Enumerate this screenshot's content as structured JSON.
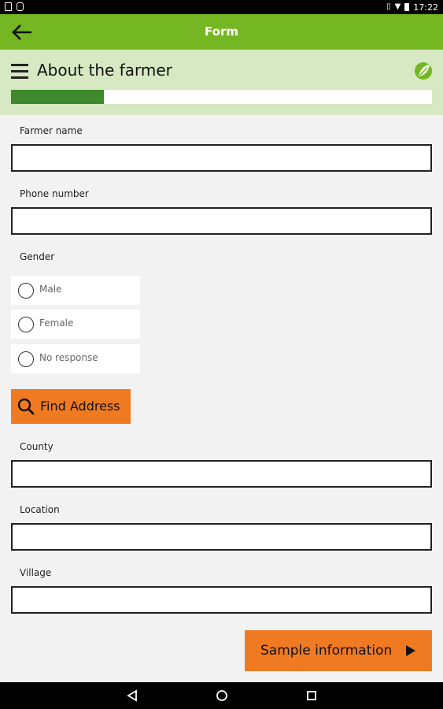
{
  "status_bar": {
    "time": "17:22",
    "icons": [
      "notification-icon",
      "notification-icon",
      "vibrate-icon",
      "wifi-icon",
      "battery-icon"
    ]
  },
  "app_bar": {
    "title": "Form",
    "back_icon": "back-arrow-icon"
  },
  "section": {
    "title": "About the farmer",
    "menu_icon": "hamburger-menu-icon",
    "logo_icon": "leaf-icon",
    "progress": 0.22,
    "colors": {
      "track": "#ffffff",
      "fill": "#3e8a2c",
      "header_bg": "#d6e9c3"
    }
  },
  "form": {
    "farmer_name": {
      "label": "Farmer name",
      "value": ""
    },
    "phone_number": {
      "label": "Phone number",
      "value": ""
    },
    "gender": {
      "label": "Gender",
      "options": [
        "Male",
        "Female",
        "No response"
      ],
      "selected": null
    },
    "find_address": {
      "label": "Find Address",
      "icon": "search-icon"
    },
    "county": {
      "label": "County",
      "value": ""
    },
    "location": {
      "label": "Location",
      "value": ""
    },
    "village": {
      "label": "Village",
      "value": ""
    },
    "next_button": {
      "label": "Sample information",
      "icon": "play-arrow-icon"
    }
  },
  "nav_bar": {
    "icons": [
      "back-triangle-icon",
      "home-circle-icon",
      "recents-square-icon"
    ]
  },
  "colors": {
    "accent_green": "#74b722",
    "button_orange": "#f07a22",
    "background": "#f2f2f2"
  }
}
